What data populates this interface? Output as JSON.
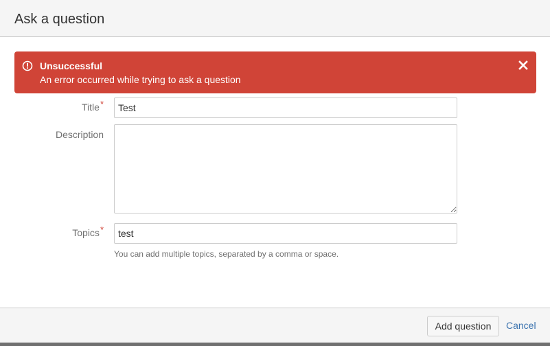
{
  "dialog": {
    "title": "Ask a question"
  },
  "error": {
    "title": "Unsuccessful",
    "message": "An error occurred while trying to ask a question",
    "color": "#d04437"
  },
  "form": {
    "title": {
      "label": "Title",
      "required_mark": "*",
      "value": "Test"
    },
    "description": {
      "label": "Description",
      "value": ""
    },
    "topics": {
      "label": "Topics",
      "required_mark": "*",
      "value": "test",
      "help": "You can add multiple topics, separated by a comma or space."
    }
  },
  "footer": {
    "submit_label": "Add question",
    "cancel_label": "Cancel",
    "link_color": "#3b73af"
  },
  "icons": {
    "error": "exclamation-circle-icon",
    "close": "close-icon"
  }
}
